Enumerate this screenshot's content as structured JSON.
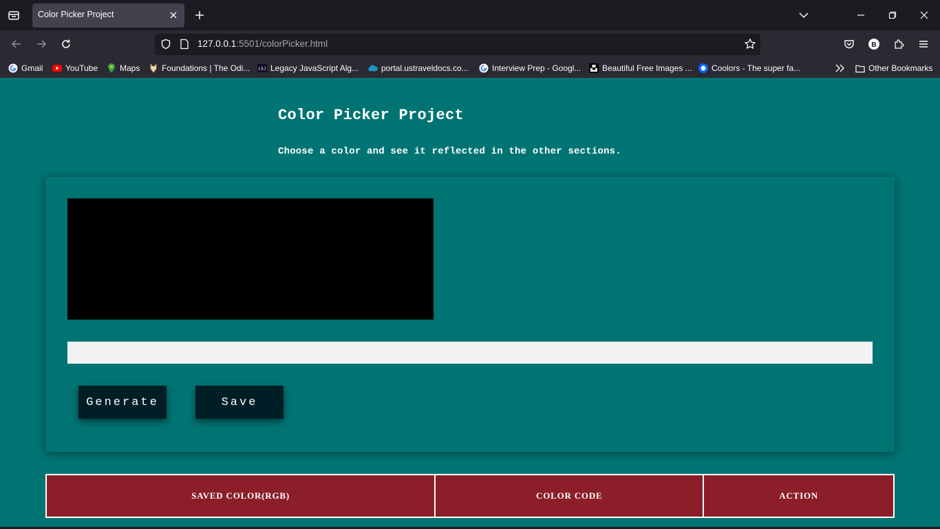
{
  "browser": {
    "tab": {
      "title": "Color Picker Project"
    },
    "url": {
      "host": "127.0.0.1",
      "rest": ":5501/colorPicker.html"
    },
    "bookmarks": [
      {
        "label": "Gmail",
        "icon": "google-icon"
      },
      {
        "label": "YouTube",
        "icon": "youtube-icon"
      },
      {
        "label": "Maps",
        "icon": "maps-pin-icon"
      },
      {
        "label": "Foundations | The Odi...",
        "icon": "odin-icon"
      },
      {
        "label": "Legacy JavaScript Alg...",
        "icon": "freecodecamp-icon"
      },
      {
        "label": "portal.ustraveldocs.co...",
        "icon": "salesforce-cloud-icon"
      },
      {
        "label": "Interview Prep - Googl...",
        "icon": "google-icon"
      },
      {
        "label": "Beautiful Free Images ...",
        "icon": "unsplash-icon"
      },
      {
        "label": "Coolors - The super fa...",
        "icon": "coolors-icon"
      }
    ],
    "other_bookmarks": "Other Bookmarks",
    "profile_initial": "B"
  },
  "page": {
    "title": "Color Picker Project",
    "subtitle": "Choose a color and see it reflected in the other sections.",
    "swatch_color": "#000000",
    "color_input": {
      "value": "",
      "placeholder": ""
    },
    "buttons": {
      "generate": "Generate",
      "save": "Save"
    },
    "table": {
      "headers": [
        "SAVED COLOR(RGB)",
        "COLOR CODE",
        "ACTION"
      ]
    }
  },
  "colors": {
    "page_bg": "#007473",
    "button_bg": "#001e26",
    "table_header_bg": "#8b1e29",
    "input_bg": "#f2f2f2"
  }
}
